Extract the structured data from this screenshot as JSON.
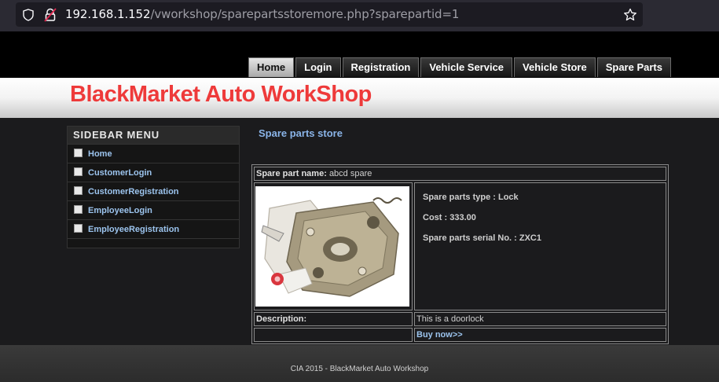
{
  "browser": {
    "url_host": "192.168.1.152",
    "url_path": "/vworkshop/sparepartsstoremore.php?sparepartid=1"
  },
  "nav": {
    "tabs": [
      "Home",
      "Login",
      "Registration",
      "Vehicle Service",
      "Vehicle Store",
      "Spare Parts"
    ],
    "active": "Home"
  },
  "site": {
    "title": "BlackMarket Auto WorkShop"
  },
  "sidebar": {
    "heading": "SIDEBAR MENU",
    "items": [
      {
        "label": "Home"
      },
      {
        "label": "CustomerLogin"
      },
      {
        "label": "CustomerRegistration"
      },
      {
        "label": "EmployeeLogin"
      },
      {
        "label": "EmployeeRegistration"
      }
    ]
  },
  "content": {
    "title": "Spare parts store",
    "name_label": "Spare part name:",
    "name_value": "abcd spare",
    "type_line": "Spare parts type : Lock",
    "cost_line": "Cost : 333.00",
    "serial_line": "Spare parts serial No. : ZXC1",
    "description_label": "Description:",
    "description_value": "This is a doorlock",
    "buy_label": "Buy now>>"
  },
  "footer": {
    "text": "CIA 2015 - BlackMarket Auto Workshop"
  }
}
